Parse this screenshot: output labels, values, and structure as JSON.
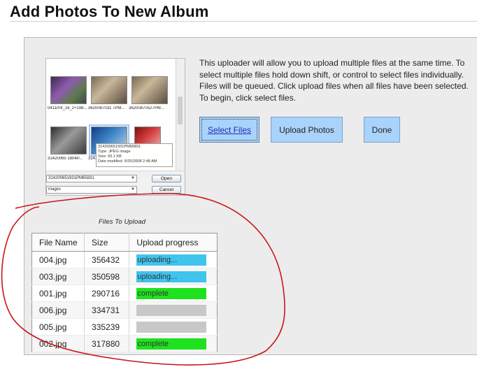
{
  "page": {
    "title": "Add Photos To New Album"
  },
  "instructions": "This uploader will allow you to upload multiple files at the same time. To select multiple files hold down shift, or control to select files individually. Files will be queued. Click upload files when all files have been selected. To begin, click select files.",
  "buttons": {
    "select_files": "Select Files",
    "upload_photos": "Upload Photos",
    "done": "Done"
  },
  "file_dialog": {
    "thumbnails": [
      {
        "label": "0411rmt_16_z+198...",
        "style": "purple"
      },
      {
        "label": "3620087031 7PM...",
        "style": "shop"
      },
      {
        "label": "36200870527PM...",
        "style": "shop"
      },
      {
        "label": "31420065 1804P...",
        "style": "engine"
      },
      {
        "label": "314...",
        "style": "blue"
      },
      {
        "label": "",
        "style": "red"
      }
    ],
    "tooltip_lines": [
      "314200651931PM65831",
      "Type: JPEG image",
      "Size: 93.1 KB",
      "Date modified: 9/25/2008 2:48 AM"
    ],
    "filename_value": "314200651931PM65831",
    "filetype_value": "mages",
    "open_label": "Open",
    "cancel_label": "Cancel"
  },
  "queue": {
    "caption": "Files To Upload",
    "columns": [
      "File Name",
      "Size",
      "Upload progress"
    ],
    "rows": [
      {
        "name": "004.jpg",
        "size": "356432",
        "status": "uploading...",
        "progress": 1.0,
        "color": "#3fc4ee"
      },
      {
        "name": "003.jpg",
        "size": "350598",
        "status": "uploading...",
        "progress": 1.0,
        "color": "#3fc4ee"
      },
      {
        "name": "001.jpg",
        "size": "290716",
        "status": "complete",
        "progress": 1.0,
        "color": "#1fe21f"
      },
      {
        "name": "006.jpg",
        "size": "334731",
        "status": "",
        "progress": 0.0,
        "color": "#c8c8c8"
      },
      {
        "name": "005.jpg",
        "size": "335239",
        "status": "",
        "progress": 0.0,
        "color": "#c8c8c8"
      },
      {
        "name": "002.jpg",
        "size": "317880",
        "status": "complete",
        "progress": 1.0,
        "color": "#1fe21f"
      }
    ]
  },
  "colors": {
    "button_bg": "#a9d3fb",
    "annotation_red": "#c7161a"
  }
}
